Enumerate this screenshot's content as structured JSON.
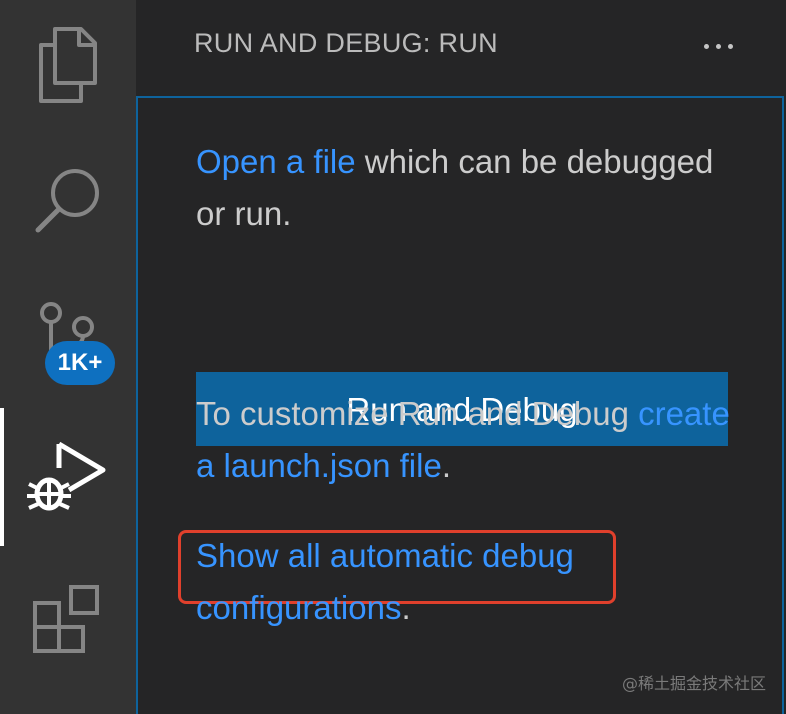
{
  "activity_bar": {
    "items": [
      {
        "name": "explorer",
        "icon": "files-icon"
      },
      {
        "name": "search",
        "icon": "search-icon"
      },
      {
        "name": "source-control",
        "icon": "source-control-icon",
        "badge": "1K+"
      },
      {
        "name": "run-and-debug",
        "icon": "debug-alt-icon",
        "active": true
      },
      {
        "name": "extensions",
        "icon": "extensions-icon"
      }
    ],
    "badge_text": "1K+"
  },
  "sidebar": {
    "title": "RUN AND DEBUG: RUN",
    "more_label": "···",
    "welcome": {
      "open_file_link": "Open a file",
      "open_file_rest": " which can be debugged or run.",
      "run_button": "Run and Debug",
      "customize_text": "To customize Run and Debug ",
      "launch_link": "create a launch.json file",
      "launch_period": ".",
      "show_all_link": "Show all automatic debug configurations",
      "show_all_period": "."
    }
  },
  "watermark": "@稀土掘金技术社区",
  "colors": {
    "activity_bg": "#333333",
    "sidebar_bg": "#252526",
    "link": "#3794ff",
    "button": "#0e639c",
    "badge": "#0e70c0",
    "highlight": "#e0402c"
  }
}
